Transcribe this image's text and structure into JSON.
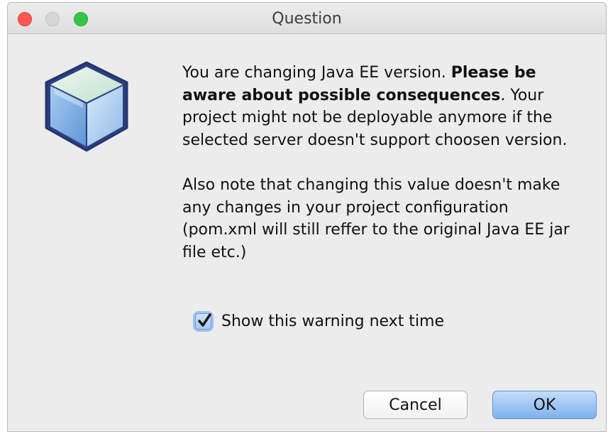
{
  "window": {
    "title": "Question"
  },
  "icon": {
    "name": "netbeans-cube-icon"
  },
  "message": {
    "paragraph1_plain1": "You are changing Java EE version. ",
    "paragraph1_bold": "Please be aware about possible consequences",
    "paragraph1_plain2": ". Your project might not be deployable anymore if the selected server doesn't support choosen version.",
    "paragraph2": "Also note that changing this value doesn't make any changes in your project configuration (pom.xml will still reffer to the original Java EE jar file etc.)"
  },
  "checkbox": {
    "label": "Show this warning next time",
    "checked": true
  },
  "buttons": {
    "cancel_label": "Cancel",
    "ok_label": "OK"
  },
  "colors": {
    "close": "#fc5753",
    "minimize": "#d6d6d6",
    "zoom": "#33c748",
    "default_button": "#7fb1ef"
  }
}
